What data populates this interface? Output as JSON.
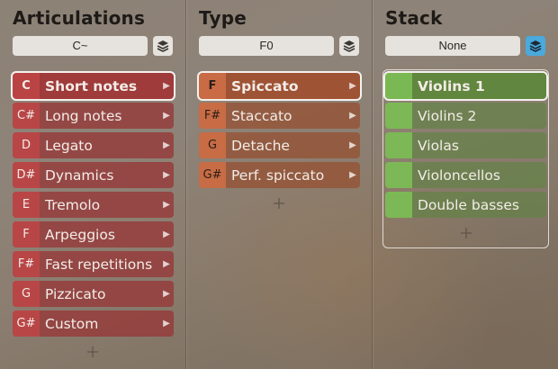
{
  "articulations": {
    "title": "Articulations",
    "selector_value": "C~",
    "stack_icon": "layers-icon",
    "items": [
      {
        "key": "C",
        "label": "Short notes",
        "selected": true
      },
      {
        "key": "C#",
        "label": "Long notes"
      },
      {
        "key": "D",
        "label": "Legato"
      },
      {
        "key": "D#",
        "label": "Dynamics"
      },
      {
        "key": "E",
        "label": "Tremolo"
      },
      {
        "key": "F",
        "label": "Arpeggios"
      },
      {
        "key": "F#",
        "label": "Fast repetitions"
      },
      {
        "key": "G",
        "label": "Pizzicato"
      },
      {
        "key": "G#",
        "label": "Custom"
      }
    ]
  },
  "type": {
    "title": "Type",
    "selector_value": "F0",
    "stack_icon": "layers-icon",
    "items": [
      {
        "key": "F",
        "label": "Spiccato",
        "selected": true
      },
      {
        "key": "F#",
        "label": "Staccato"
      },
      {
        "key": "G",
        "label": "Detache"
      },
      {
        "key": "G#",
        "label": "Perf. spiccato"
      }
    ]
  },
  "stack": {
    "title": "Stack",
    "selector_value": "None",
    "stack_icon": "layers-icon",
    "items": [
      {
        "label": "Violins 1",
        "selected": true
      },
      {
        "label": "Violins 2"
      },
      {
        "label": "Violas"
      },
      {
        "label": "Violoncellos"
      },
      {
        "label": "Double basses"
      }
    ]
  },
  "colors": {
    "articulation_accent": "#be4646",
    "type_accent": "#cd6e46",
    "stack_accent": "#7dbe55",
    "stack_button_active": "#4aa9dd"
  }
}
